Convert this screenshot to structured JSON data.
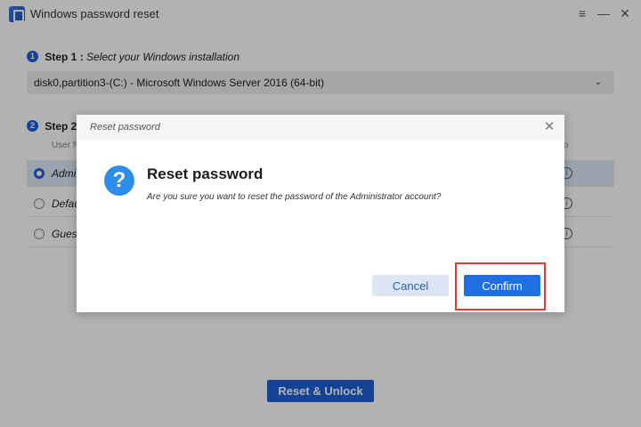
{
  "window": {
    "title": "Windows password reset",
    "controls": {
      "menu": "≡",
      "minimize": "—",
      "close": "✕"
    }
  },
  "step1": {
    "badge": "1",
    "label": "Step 1 :",
    "description": "Select your Windows installation",
    "selected_value": "disk0,partition3-(C:) - Microsoft Windows Server 2016 (64-bit)",
    "chevron": "⌄"
  },
  "step2": {
    "badge": "2",
    "label": "Step 2",
    "columns": {
      "user": "User N",
      "info": "fo"
    },
    "rows": [
      {
        "name": "Admi",
        "selected": true
      },
      {
        "name": "Defau",
        "selected": false
      },
      {
        "name": "Guest",
        "selected": false
      }
    ]
  },
  "unlock_button": "Reset & Unlock",
  "dialog": {
    "header_title": "Reset password",
    "close": "✕",
    "icon": "?",
    "heading": "Reset password",
    "message": "Are you sure you want to reset the password of the Administrator account?",
    "cancel_label": "Cancel",
    "confirm_label": "Confirm"
  },
  "colors": {
    "accent": "#1e5fd6",
    "confirm": "#1e6fe0",
    "cancel_bg": "#dce6f5",
    "question_icon": "#2d8ee8",
    "highlight": "#e53935"
  },
  "icons": {
    "app": "app-logo-icon",
    "step_badge": "numbered-badge-icon",
    "info": "info-icon",
    "question": "question-icon"
  }
}
